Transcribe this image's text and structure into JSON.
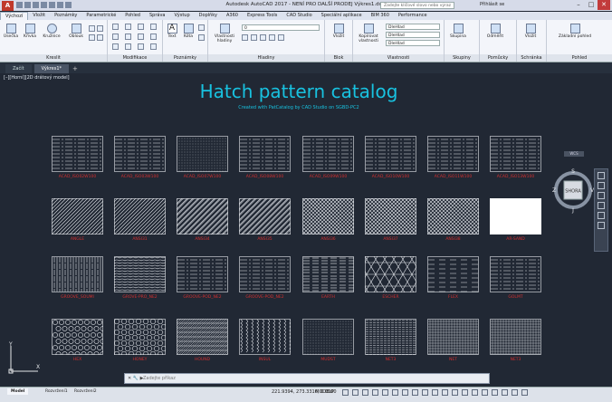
{
  "app": {
    "title": "Autodesk AutoCAD 2017 - NENÍ PRO DALŠÍ PRODEJ    Výkres1.dwg",
    "search_placeholder": "Zadejte klíčové slovo nebo výraz",
    "login": "Přihlásit se"
  },
  "ribbon_tabs": [
    "Výchozí",
    "Vložit",
    "Poznámky",
    "Parametrické",
    "Pohled",
    "Správa",
    "Výstup",
    "Doplňky",
    "A360",
    "Express Tools",
    "CAD Studio",
    "Speciální aplikace",
    "BIM 360",
    "Performance"
  ],
  "panels": {
    "kresli": "Kreslit",
    "modifikace": "Modifikace",
    "poznamky": "Poznámky",
    "hladiny": "Hladiny",
    "blok": "Blok",
    "vlastnosti": "Vlastnosti",
    "skupiny": "Skupiny",
    "pomucky": "Pomůcky",
    "schranka": "Schránka",
    "pohled": "Pohled"
  },
  "tools": {
    "usecka": "Úsečka",
    "krivka": "Křivka",
    "kruznice": "Kružnice",
    "oblouk": "Oblouk",
    "text": "Text",
    "kota": "Kóta",
    "vlastnosti_hladiny": "Vlastnosti hladiny",
    "vlozit": "Vložit",
    "kopirovat_vlastnosti": "Kopírovat vlastnosti",
    "skupina": "Skupina",
    "odmerit": "Odměřit",
    "vlozit2": "Vložit",
    "zakladni_pohled": "Základní pohled",
    "layer_value": "0",
    "prop_dropdown_1": "DleHlad",
    "prop_dropdown_2": "DleHlad",
    "prop_dropdown_3": "DleHlad"
  },
  "doc_tabs": {
    "start": "Začít",
    "drawing": "Výkres1*"
  },
  "viewport": {
    "label": "[–][Horní][2D drátový model]",
    "heading": "Hatch pattern catalog",
    "subtitle": "Created with PatCatalog by CAD Studio on SGBD-PC2"
  },
  "navcube": {
    "face": "SHORA",
    "north": "S",
    "east": "V",
    "west": "Z",
    "south": "J",
    "wcs": "WCS"
  },
  "ucs": {
    "x": "X",
    "y": "Y"
  },
  "colors": {
    "title_cyan": "#18c2e0",
    "label_red": "#d42f2f",
    "viewport_bg": "#212834"
  },
  "hatches": [
    {
      "name": "ACAD_ISO02W100",
      "style": "dashed-h"
    },
    {
      "name": "ACAD_ISO03W100",
      "style": "dashed-h"
    },
    {
      "name": "ACAD_ISO07W100",
      "style": "dots"
    },
    {
      "name": "ACAD_ISO08W100",
      "style": "dashed-h"
    },
    {
      "name": "ACAD_ISO09W100",
      "style": "dashed-h"
    },
    {
      "name": "ACAD_ISO10W100",
      "style": "dashed-h"
    },
    {
      "name": "ACAD_ISO11W100",
      "style": "dashed-h"
    },
    {
      "name": "ACAD_ISO13W100",
      "style": "dashed-h"
    },
    {
      "name": "ANGLE",
      "style": "diag"
    },
    {
      "name": "ANSI31",
      "style": "diag"
    },
    {
      "name": "ANSI34",
      "style": "diag2"
    },
    {
      "name": "ANSI35",
      "style": "diag2"
    },
    {
      "name": "ANSI36",
      "style": "cross"
    },
    {
      "name": "ANSI37",
      "style": "cross"
    },
    {
      "name": "ANSI38",
      "style": "cross"
    },
    {
      "name": "AR-SAND",
      "style": "solid"
    },
    {
      "name": "GROOVE_SOUMI",
      "style": "vert"
    },
    {
      "name": "GROVE-PRO_NE2",
      "style": "wavy"
    },
    {
      "name": "GROOVE-POD_NE2",
      "style": "dashed-h"
    },
    {
      "name": "GROOVE-POD_NE2",
      "style": "dashed-h"
    },
    {
      "name": "EARTH",
      "style": "earth"
    },
    {
      "name": "ESCHER",
      "style": "escher"
    },
    {
      "name": "FLEX",
      "style": "flex"
    },
    {
      "name": "GOLMT",
      "style": "dashed-h"
    },
    {
      "name": "HEX",
      "style": "circles"
    },
    {
      "name": "HONEY",
      "style": "hex"
    },
    {
      "name": "HOUND",
      "style": "hound"
    },
    {
      "name": "INSUL",
      "style": "insul"
    },
    {
      "name": "MUDST",
      "style": "dots"
    },
    {
      "name": "NET3",
      "style": "wave"
    },
    {
      "name": "NET",
      "style": "grid"
    },
    {
      "name": "NET3",
      "style": "grid"
    }
  ],
  "command_line": {
    "placeholder": "Zadejte příkaz"
  },
  "layout_tabs": [
    "Model",
    "Rozvržení1",
    "Rozvržení2"
  ],
  "status": {
    "coords": "221.9394, 273.3316, 0.0000",
    "mode": "MODELP"
  }
}
